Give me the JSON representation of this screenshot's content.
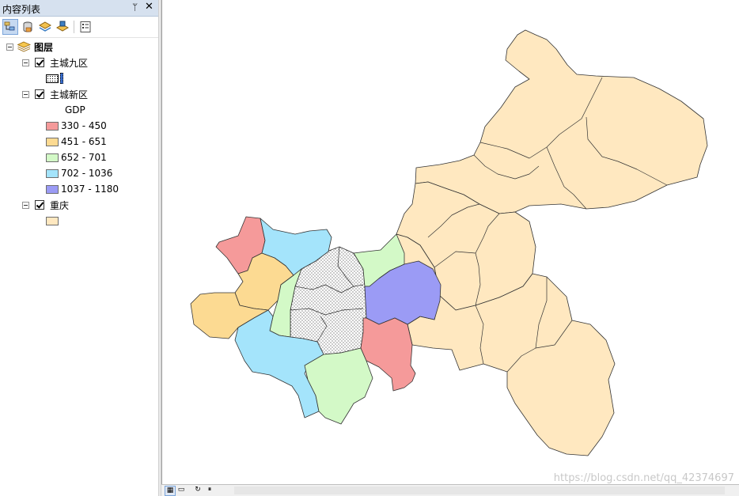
{
  "toc": {
    "title": "内容列表",
    "pin_glyph": "ᛘ",
    "close_glyph": "✕",
    "toolbar": [
      "list-by-drawing-order-icon",
      "list-by-source-icon",
      "list-by-visibility-icon",
      "list-by-selection-icon",
      "options-icon"
    ],
    "layers_root": "图层",
    "layer1": {
      "name": "主城九区"
    },
    "layer2": {
      "name": "主城新区",
      "field": "GDP",
      "classes": [
        {
          "label": "330 - 450",
          "color": "#f59a9a"
        },
        {
          "label": "451 - 651",
          "color": "#fcda92"
        },
        {
          "label": "652 - 701",
          "color": "#d3f9c7"
        },
        {
          "label": "702 - 1036",
          "color": "#a4e4fb"
        },
        {
          "label": "1037 - 1180",
          "color": "#9b9bf5"
        }
      ]
    },
    "layer3": {
      "name": "重庆",
      "color": "#ffe8c0"
    }
  },
  "map": {
    "colors": {
      "base": "#ffe8c0",
      "outline": "#333333"
    }
  },
  "watermark": "https://blog.csdn.net/qq_42374697"
}
